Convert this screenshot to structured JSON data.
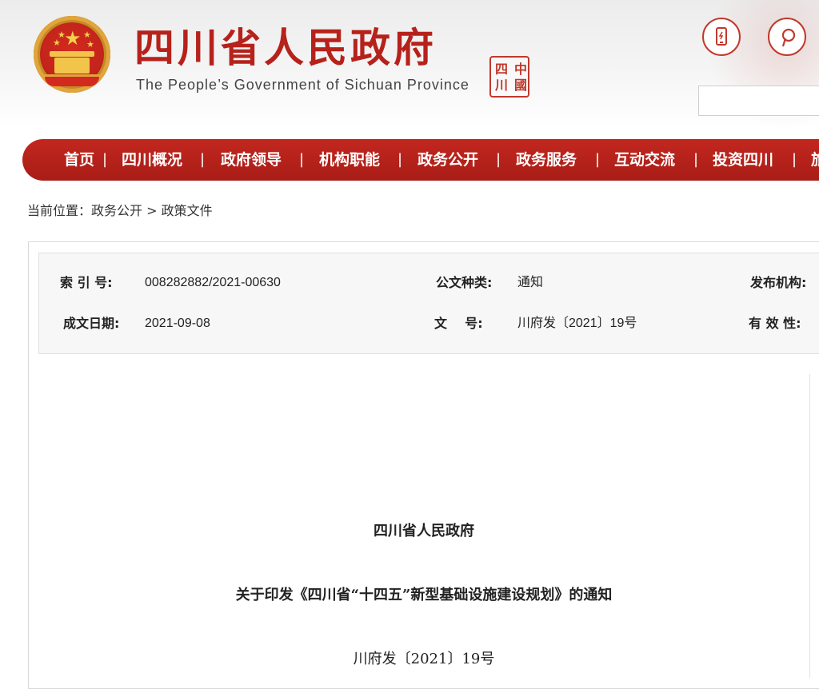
{
  "header": {
    "title_cn": "四川省人民政府",
    "title_en": "The People’s Government of Sichuan Province",
    "seal_text": "中國四川",
    "search_placeholder": ""
  },
  "icons": {
    "emblem": "national-emblem-icon",
    "phone": "mobile-phone-icon",
    "social": "weibo-social-icon"
  },
  "colors": {
    "brand_red": "#b6221b",
    "nav_red": "#c2271f"
  },
  "nav": {
    "items": [
      {
        "label": "首页"
      },
      {
        "label": "四川概况"
      },
      {
        "label": "政府领导"
      },
      {
        "label": "机构职能"
      },
      {
        "label": "政务公开"
      },
      {
        "label": "政务服务"
      },
      {
        "label": "互动交流"
      },
      {
        "label": "投资四川"
      },
      {
        "label": "旅"
      }
    ],
    "separator": "|"
  },
  "breadcrumb": {
    "prefix": "当前位置：",
    "level1": "政务公开",
    "sep": ">",
    "level2": "政策文件"
  },
  "meta": {
    "index_label": "索 引 号:",
    "index_value": "008282882/2021-00630",
    "doc_type_label": "公文种类:",
    "doc_type_value": "通知",
    "publisher_label": "发布机构:",
    "date_label": "成文日期:",
    "date_value": "2021-09-08",
    "doc_no_label": "文    号:",
    "doc_no_value": "川府发〔2021〕19号",
    "validity_label": "有 效 性:"
  },
  "document": {
    "issuer": "四川省人民政府",
    "title": "关于印发《四川省“十四五”新型基础设施建设规划》的通知",
    "number": "川府发〔2021〕19号"
  }
}
